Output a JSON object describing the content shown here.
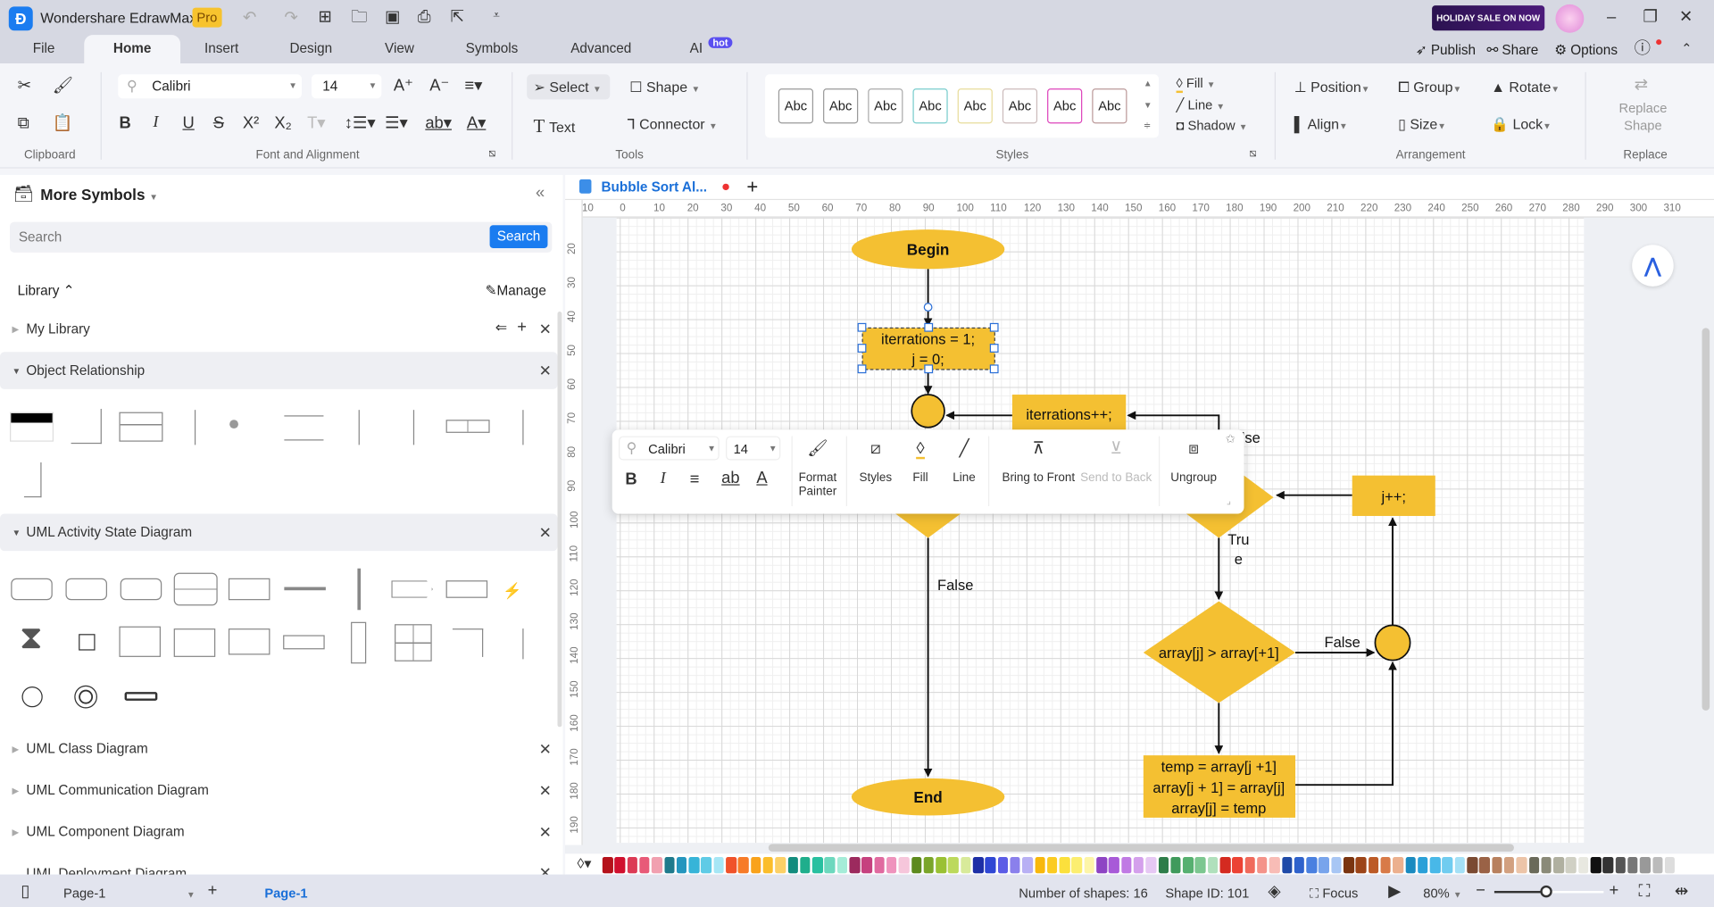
{
  "app": {
    "title": "Wondershare EdrawMax",
    "badge": "Pro",
    "promo": "HOLIDAY SALE ON NOW"
  },
  "header_actions": {
    "publish": "Publish",
    "share": "Share",
    "options": "Options"
  },
  "tabs": [
    "File",
    "Home",
    "Insert",
    "Design",
    "View",
    "Symbols",
    "Advanced",
    "AI"
  ],
  "ai_badge": "hot",
  "ribbon": {
    "font": "Calibri",
    "size": "14",
    "groups": {
      "clipboard": "Clipboard",
      "font": "Font and Alignment",
      "tools": "Tools",
      "styles": "Styles",
      "arrangement": "Arrangement",
      "replace": "Replace"
    },
    "select": "Select",
    "shape": "Shape",
    "text": "Text",
    "connector": "Connector",
    "style_samples": [
      "Abc",
      "Abc",
      "Abc",
      "Abc",
      "Abc",
      "Abc",
      "Abc",
      "Abc"
    ],
    "fill": "Fill",
    "line": "Line",
    "shadow": "Shadow",
    "position": "Position",
    "group": "Group",
    "rotate": "Rotate",
    "align": "Align",
    "size_btn": "Size",
    "lock": "Lock",
    "replace_shape": "Replace Shape"
  },
  "panel": {
    "title": "More Symbols",
    "search_placeholder": "Search",
    "search_btn": "Search",
    "library": "Library",
    "manage": "Manage",
    "my_library": "My Library",
    "sections": [
      "Object Relationship",
      "UML Activity State Diagram",
      "UML Class Diagram",
      "UML Communication Diagram",
      "UML Component Diagram",
      "UML Deployment Diagram"
    ]
  },
  "document": {
    "tab": "Bubble Sort Al..."
  },
  "ruler": {
    "h": [
      -10,
      0,
      10,
      20,
      30,
      40,
      50,
      60,
      70,
      80,
      90,
      100,
      110,
      120,
      130,
      140,
      150,
      160,
      170,
      180,
      190,
      200,
      210,
      220,
      230,
      240,
      250,
      260,
      270,
      280,
      290,
      300,
      310
    ],
    "v": [
      20,
      30,
      40,
      50,
      60,
      70,
      80,
      90,
      100,
      110,
      120,
      130,
      140,
      150,
      160,
      170,
      180,
      190
    ]
  },
  "diagram": {
    "begin": "Begin",
    "init1": "iterrations = 1;",
    "init2": "j = 0;",
    "incr": "iterrations++;",
    "false_top": "False",
    "jpp": "j++;",
    "true1": "Tru",
    "true2": "e",
    "compare": "array[j] > array[+1]",
    "false_right": "False",
    "false_left": "False",
    "swap1": "temp = array[j +1]",
    "swap2": "array[j + 1] = array[j]",
    "swap3": "array[j] = temp",
    "end": "End",
    "shape_fill": "#F4C032"
  },
  "floatbar": {
    "font": "Calibri",
    "size": "14",
    "format_painter1": "Format",
    "format_painter2": "Painter",
    "styles": "Styles",
    "fill": "Fill",
    "line": "Line",
    "bring_front": "Bring to Front",
    "send_back": "Send to Back",
    "ungroup": "Ungroup"
  },
  "palette": [
    "#b5121b",
    "#d0102e",
    "#dc3a55",
    "#e85a78",
    "#f1a0b0",
    "#1f7a8c",
    "#2596be",
    "#37b4d8",
    "#5fcbe6",
    "#a6e6f5",
    "#f0522a",
    "#f77b28",
    "#f9a21b",
    "#fbbd2b",
    "#fcd066",
    "#128c7e",
    "#1fae8c",
    "#28c0a0",
    "#6dd8be",
    "#a5ecd8",
    "#9c2a5e",
    "#c6417f",
    "#e06aa0",
    "#ef93bd",
    "#f6c6db",
    "#5d8a1e",
    "#7aa52a",
    "#9ac134",
    "#bcd95c",
    "#d8ea9a",
    "#1d2fa6",
    "#2f47d4",
    "#5b5ce6",
    "#8a80ec",
    "#b8b0f4",
    "#f8b80c",
    "#fbcb22",
    "#fbe03c",
    "#fcee70",
    "#fdf5a8",
    "#8e44c4",
    "#a85ad8",
    "#c07ae4",
    "#d4a0ec",
    "#e6c8f4",
    "#2e7d4a",
    "#3f9a5c",
    "#56b070",
    "#7cc790",
    "#b0e0bc",
    "#d42a20",
    "#ec4234",
    "#f06a5c",
    "#f4938a",
    "#f8bcb6",
    "#1f4aa8",
    "#2f62cc",
    "#4a80e0",
    "#78a4ec",
    "#a8c6f4",
    "#7a3410",
    "#9c4418",
    "#bc5a26",
    "#d87a48",
    "#ecb08e",
    "#1a8ac0",
    "#2aa0d8",
    "#48b8e8",
    "#70ccf0",
    "#a4e0f6",
    "#7a4a32",
    "#9a6246",
    "#b8805e",
    "#d2a080",
    "#ecc4a8",
    "#6a6a5a",
    "#8a8a78",
    "#b0b0a0",
    "#d0d0c4",
    "#e8e8e0",
    "#111111",
    "#333333",
    "#555555",
    "#777777",
    "#999999",
    "#bbbbbb",
    "#dddddd",
    "#ffffff"
  ],
  "status": {
    "page_select": "Page-1",
    "page_tab": "Page-1",
    "shapes": "Number of shapes: 16",
    "shape_id": "Shape ID: 101",
    "focus": "Focus",
    "zoom": "80%",
    "zoom_level": 80
  }
}
